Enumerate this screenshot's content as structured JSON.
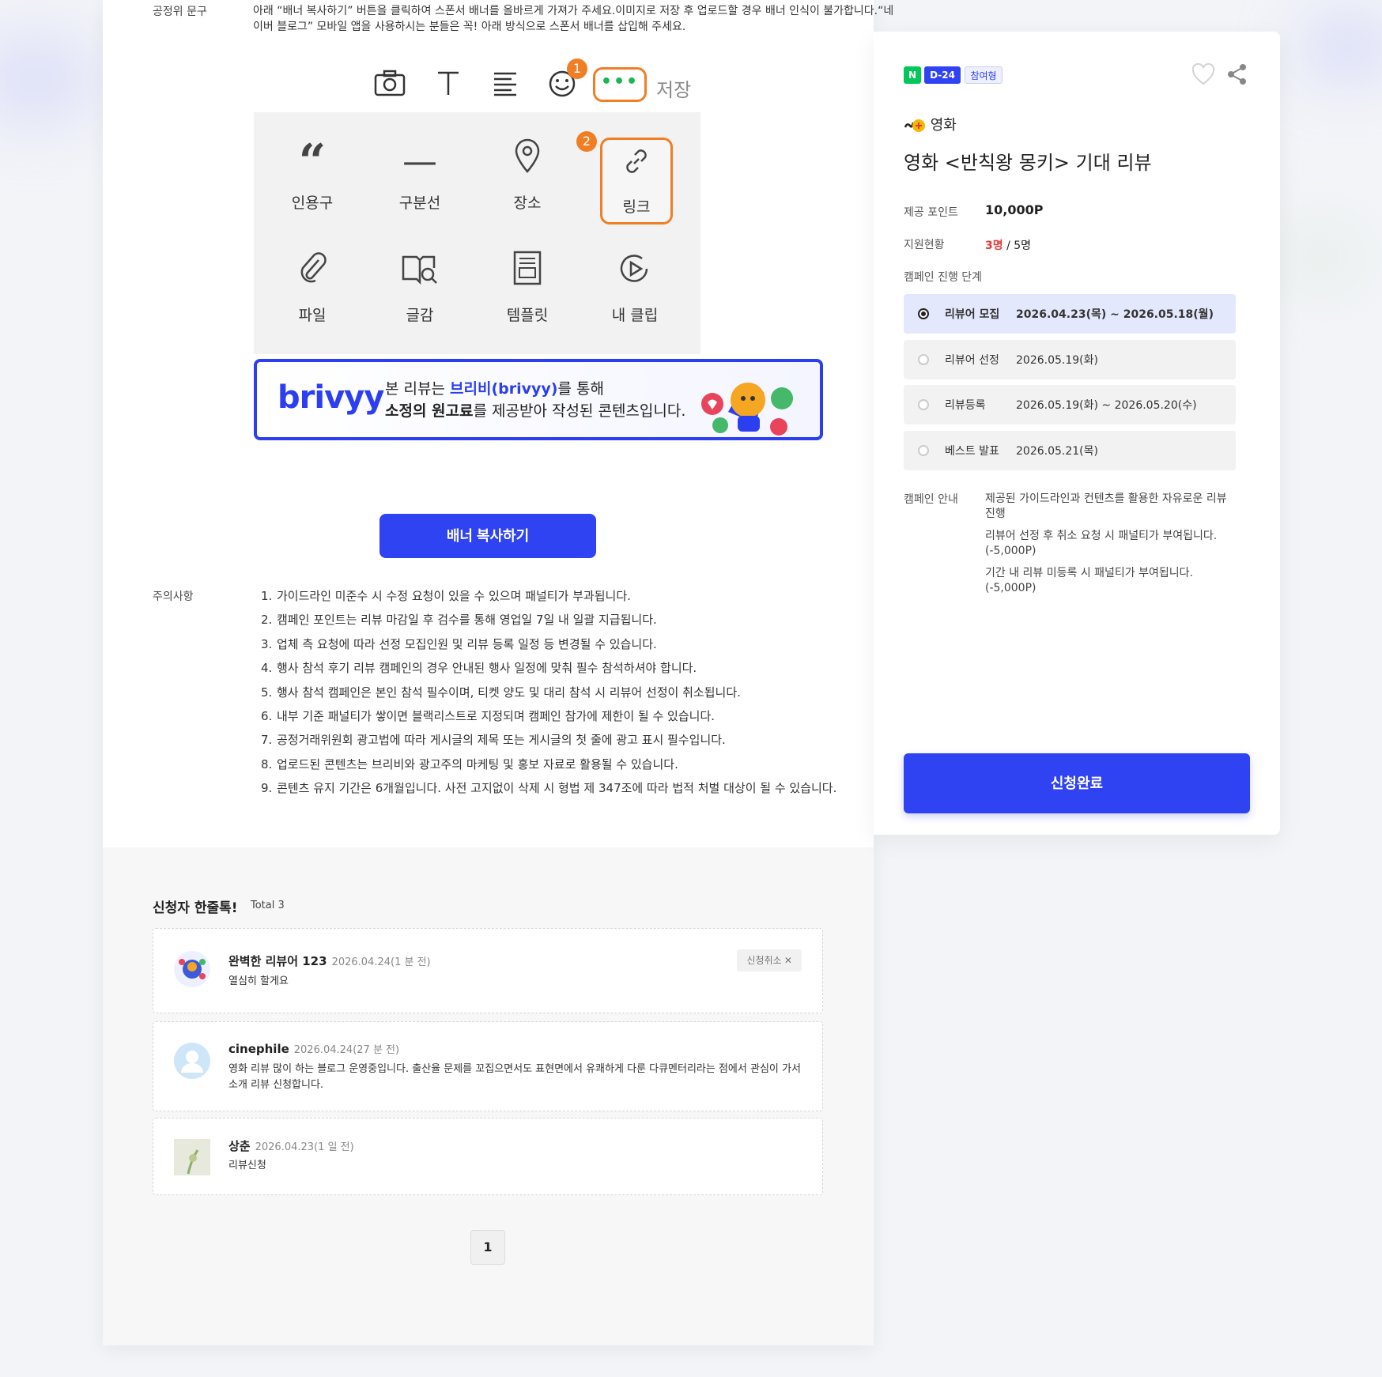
{
  "fair_notice": {
    "label": "공정위 문구",
    "text": "아래 “배너 복사하기” 버튼을 클릭하여 스폰서 배너를 올바르게 가져가 주세요.이미지로 저장 후 업로드할 경우 배너 인식이 불가합니다.“네이버 블로그” 모바일 앱을 사용하시는 분들은 꼭! 아래 방식으로 스폰서 배너를 삽입해 주세요."
  },
  "editor_guide": {
    "save_label": "저장",
    "step1": "1",
    "step2": "2",
    "more_dots": "•••",
    "items": [
      {
        "label": "인용구",
        "icon": "quote-icon"
      },
      {
        "label": "구분선",
        "icon": "divider-icon"
      },
      {
        "label": "장소",
        "icon": "location-pin-icon"
      },
      {
        "label": "링크",
        "icon": "link-icon"
      },
      {
        "label": "파일",
        "icon": "paperclip-icon"
      },
      {
        "label": "글감",
        "icon": "book-search-icon"
      },
      {
        "label": "템플릿",
        "icon": "template-icon"
      },
      {
        "label": "내 클립",
        "icon": "play-clip-icon"
      }
    ]
  },
  "banner": {
    "brand": "brivyy",
    "line1_prefix": "본 리뷰는 ",
    "line1_brand": "브리비(brivyy)",
    "line1_suffix": "를 통해",
    "line2_bold": "소정의 원고료",
    "line2_rest": "를 제공받아 작성된 콘텐츠입니다."
  },
  "copy_button": "배너 복사하기",
  "caution": {
    "label": "주의사항",
    "items": [
      "가이드라인 미준수 시 수정 요청이 있을 수 있으며 패널티가 부과됩니다.",
      "캠페인 포인트는 리뷰 마감일 후 검수를 통해 영업일 7일 내 일괄 지급됩니다.",
      "업체 측 요청에 따라 선정 모집인원 및 리뷰 등록 일정 등 변경될 수 있습니다.",
      "행사 참석 후기 리뷰 캠페인의 경우 안내된 행사 일정에 맞춰 필수 참석하셔야 합니다.",
      "행사 참석 캠페인은 본인 참석 필수이며, 티켓 양도 및 대리 참석 시 리뷰어 선정이 취소됩니다.",
      "내부 기준 패널티가 쌓이면 블랙리스트로 지정되며 캠페인 참가에 제한이 될 수 있습니다.",
      "공정거래위원회 광고법에 따라 게시글의 제목 또는 게시글의 첫 줄에 광고 표시 필수입니다.",
      "업로드된 콘텐츠는 브리비와 광고주의 마케팅 및 홍보 자료로 활용될 수 있습니다.",
      "콘텐츠 유지 기간은 6개월입니다. 사전 고지없이 삭제 시 형법 제 347조에 따라 법적 처벌 대상이 될 수 있습니다."
    ]
  },
  "applicants": {
    "title": "신청자 한줄톡!",
    "total": "Total 3",
    "cancel_label": "신청취소 ✕",
    "list": [
      {
        "name": "완벽한 리뷰어 123",
        "date": "2026.04.24(1 분 전)",
        "comment": "열심히 할게요"
      },
      {
        "name": "cinephile",
        "date": "2026.04.24(27 분 전)",
        "comment": "영화 리뷰 많이 하는 블로그 운영중입니다. 출산율 문제를 꼬집으면서도 표현면에서 유쾌하게 다룬 다큐멘터리라는 점에서 관심이 가서 소개 리뷰 신청합니다."
      },
      {
        "name": "상춘",
        "date": "2026.04.23(1 일 전)",
        "comment": "리뷰신청"
      }
    ],
    "page": "1"
  },
  "campaign": {
    "tags": [
      "N",
      "D-24",
      "참여형"
    ],
    "category": "영화",
    "title": "영화 <반칙왕 몽키> 기대 리뷰",
    "point_label": "제공 포인트",
    "point_value": "10,000P",
    "status_label": "지원현황",
    "status_current": "3명",
    "status_total": " / 5명",
    "steps_label": "캠페인 진행 단계",
    "steps": [
      {
        "name": "리뷰어 모집",
        "date": "2026.04.23(목) ~ 2026.05.18(월)"
      },
      {
        "name": "리뷰어 선정",
        "date": "2026.05.19(화)"
      },
      {
        "name": "리뷰등록",
        "date": "2026.05.19(화) ~ 2026.05.20(수)"
      },
      {
        "name": "베스트 발표",
        "date": "2026.05.21(목)"
      }
    ],
    "guide_label": "캠페인 안내",
    "guides": [
      "제공된 가이드라인과 컨텐츠를 활용한 자유로운 리뷰 진행",
      "리뷰어 선정 후 취소 요청 시 패널티가 부여됩니다. (-5,000P)",
      "기간 내 리뷰 미등록 시 패널티가 부여됩니다. (-5,000P)"
    ],
    "apply_label": "신청완료"
  },
  "colors": {
    "accent": "#2f43f2",
    "orange": "#f07e25",
    "naver": "#03c75a",
    "red": "#e53935"
  }
}
